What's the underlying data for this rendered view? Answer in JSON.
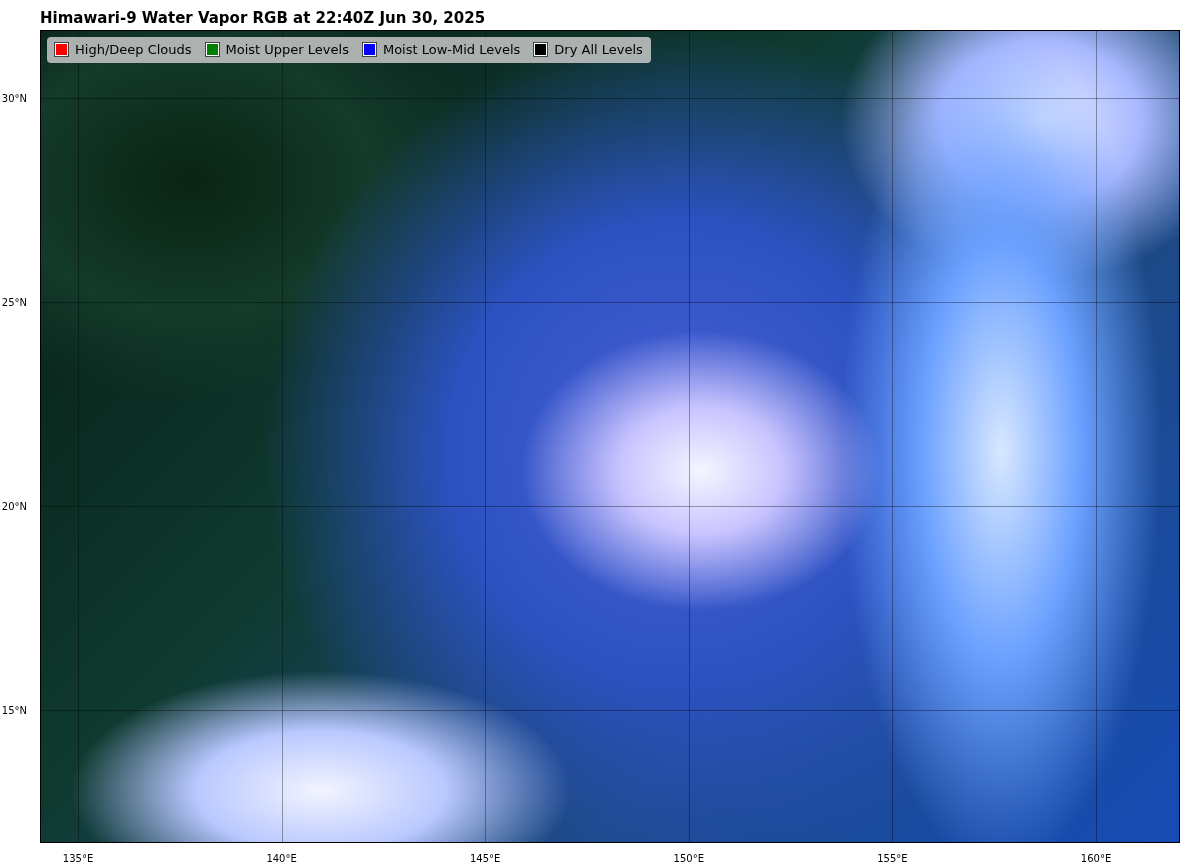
{
  "title": "Himawari-9 Water Vapor RGB at 22:40Z Jun 30, 2025",
  "legend": [
    {
      "label": "High/Deep Clouds",
      "color": "#ff0000"
    },
    {
      "label": "Moist Upper Levels",
      "color": "#008000"
    },
    {
      "label": "Moist Low-Mid Levels",
      "color": "#0000ff"
    },
    {
      "label": "Dry All Levels",
      "color": "#000000"
    }
  ],
  "y_ticks": [
    "30°N",
    "25°N",
    "20°N",
    "15°N"
  ],
  "x_ticks": [
    "135°E",
    "140°E",
    "145°E",
    "150°E",
    "155°E",
    "160°E"
  ]
}
